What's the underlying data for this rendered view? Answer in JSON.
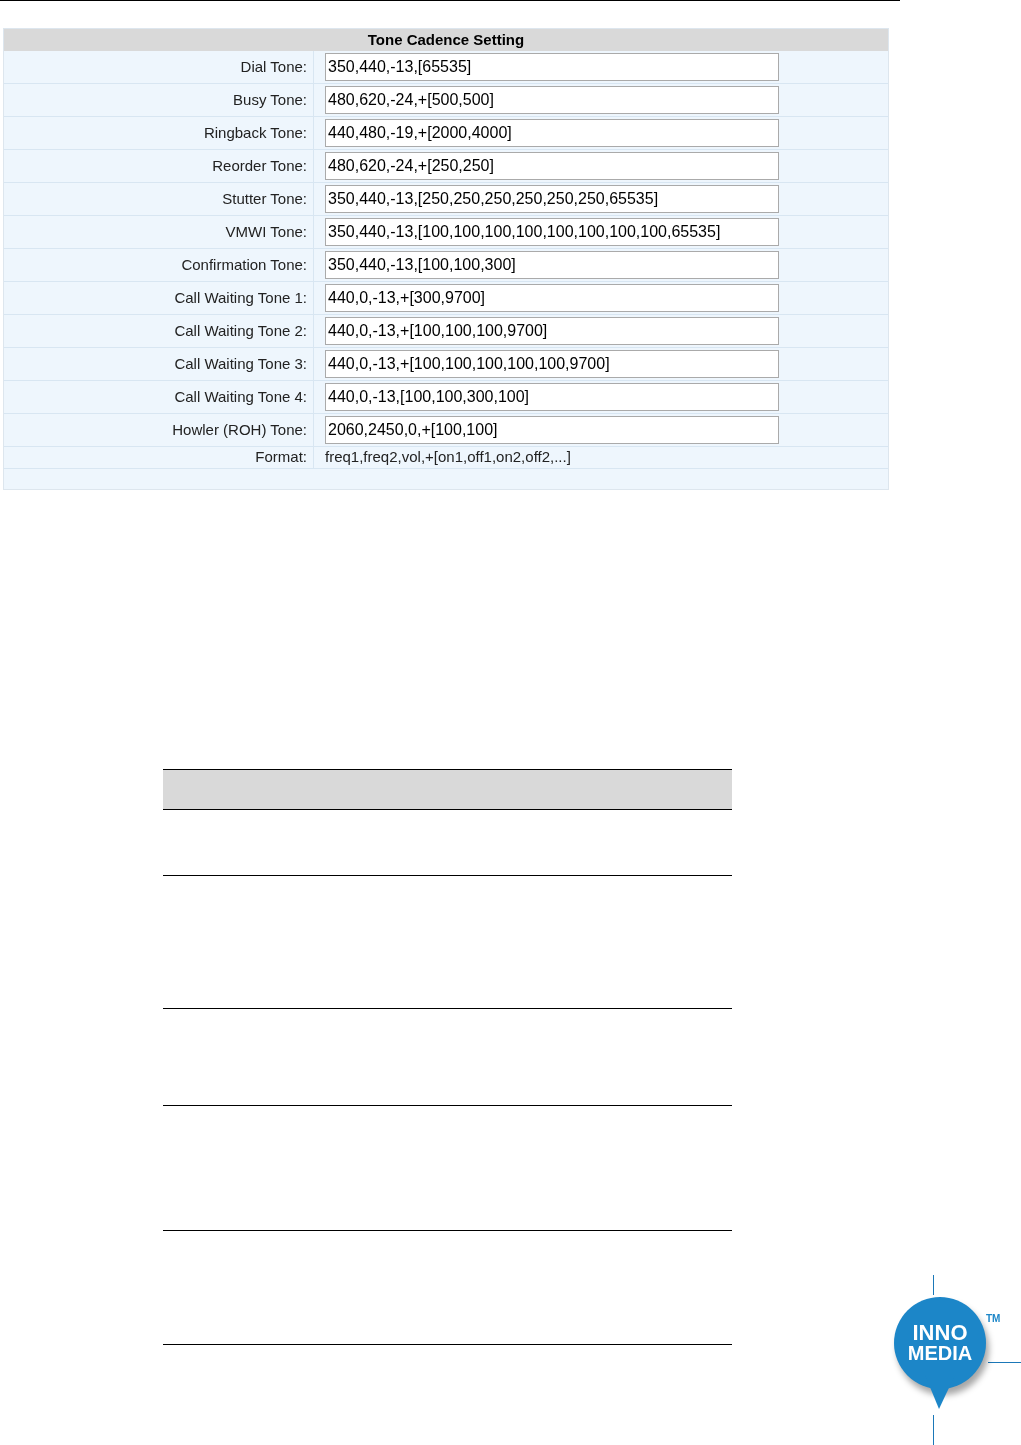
{
  "settings": {
    "title": "Tone Cadence Setting",
    "fields": [
      {
        "label": "Dial Tone:",
        "value": "350,440,-13,[65535]"
      },
      {
        "label": "Busy Tone:",
        "value": "480,620,-24,+[500,500]"
      },
      {
        "label": "Ringback Tone:",
        "value": "440,480,-19,+[2000,4000]"
      },
      {
        "label": "Reorder Tone:",
        "value": "480,620,-24,+[250,250]"
      },
      {
        "label": "Stutter Tone:",
        "value": "350,440,-13,[250,250,250,250,250,250,65535]"
      },
      {
        "label": "VMWI Tone:",
        "value": "350,440,-13,[100,100,100,100,100,100,100,100,65535]"
      },
      {
        "label": "Confirmation Tone:",
        "value": "350,440,-13,[100,100,300]"
      },
      {
        "label": "Call Waiting Tone 1:",
        "value": "440,0,-13,+[300,9700]"
      },
      {
        "label": "Call Waiting Tone 2:",
        "value": "440,0,-13,+[100,100,100,9700]"
      },
      {
        "label": "Call Waiting Tone 3:",
        "value": "440,0,-13,+[100,100,100,100,100,9700]"
      },
      {
        "label": "Call Waiting Tone 4:",
        "value": "440,0,-13,[100,100,300,100]"
      },
      {
        "label": "Howler (ROH) Tone:",
        "value": "2060,2450,0,+[100,100]"
      }
    ],
    "format": {
      "label": "Format:",
      "value": "freq1,freq2,vol,+[on1,off1,on2,off2,...]"
    }
  },
  "logo": {
    "line1": "INNO",
    "line2": "MEDIA",
    "mark": "TM"
  }
}
